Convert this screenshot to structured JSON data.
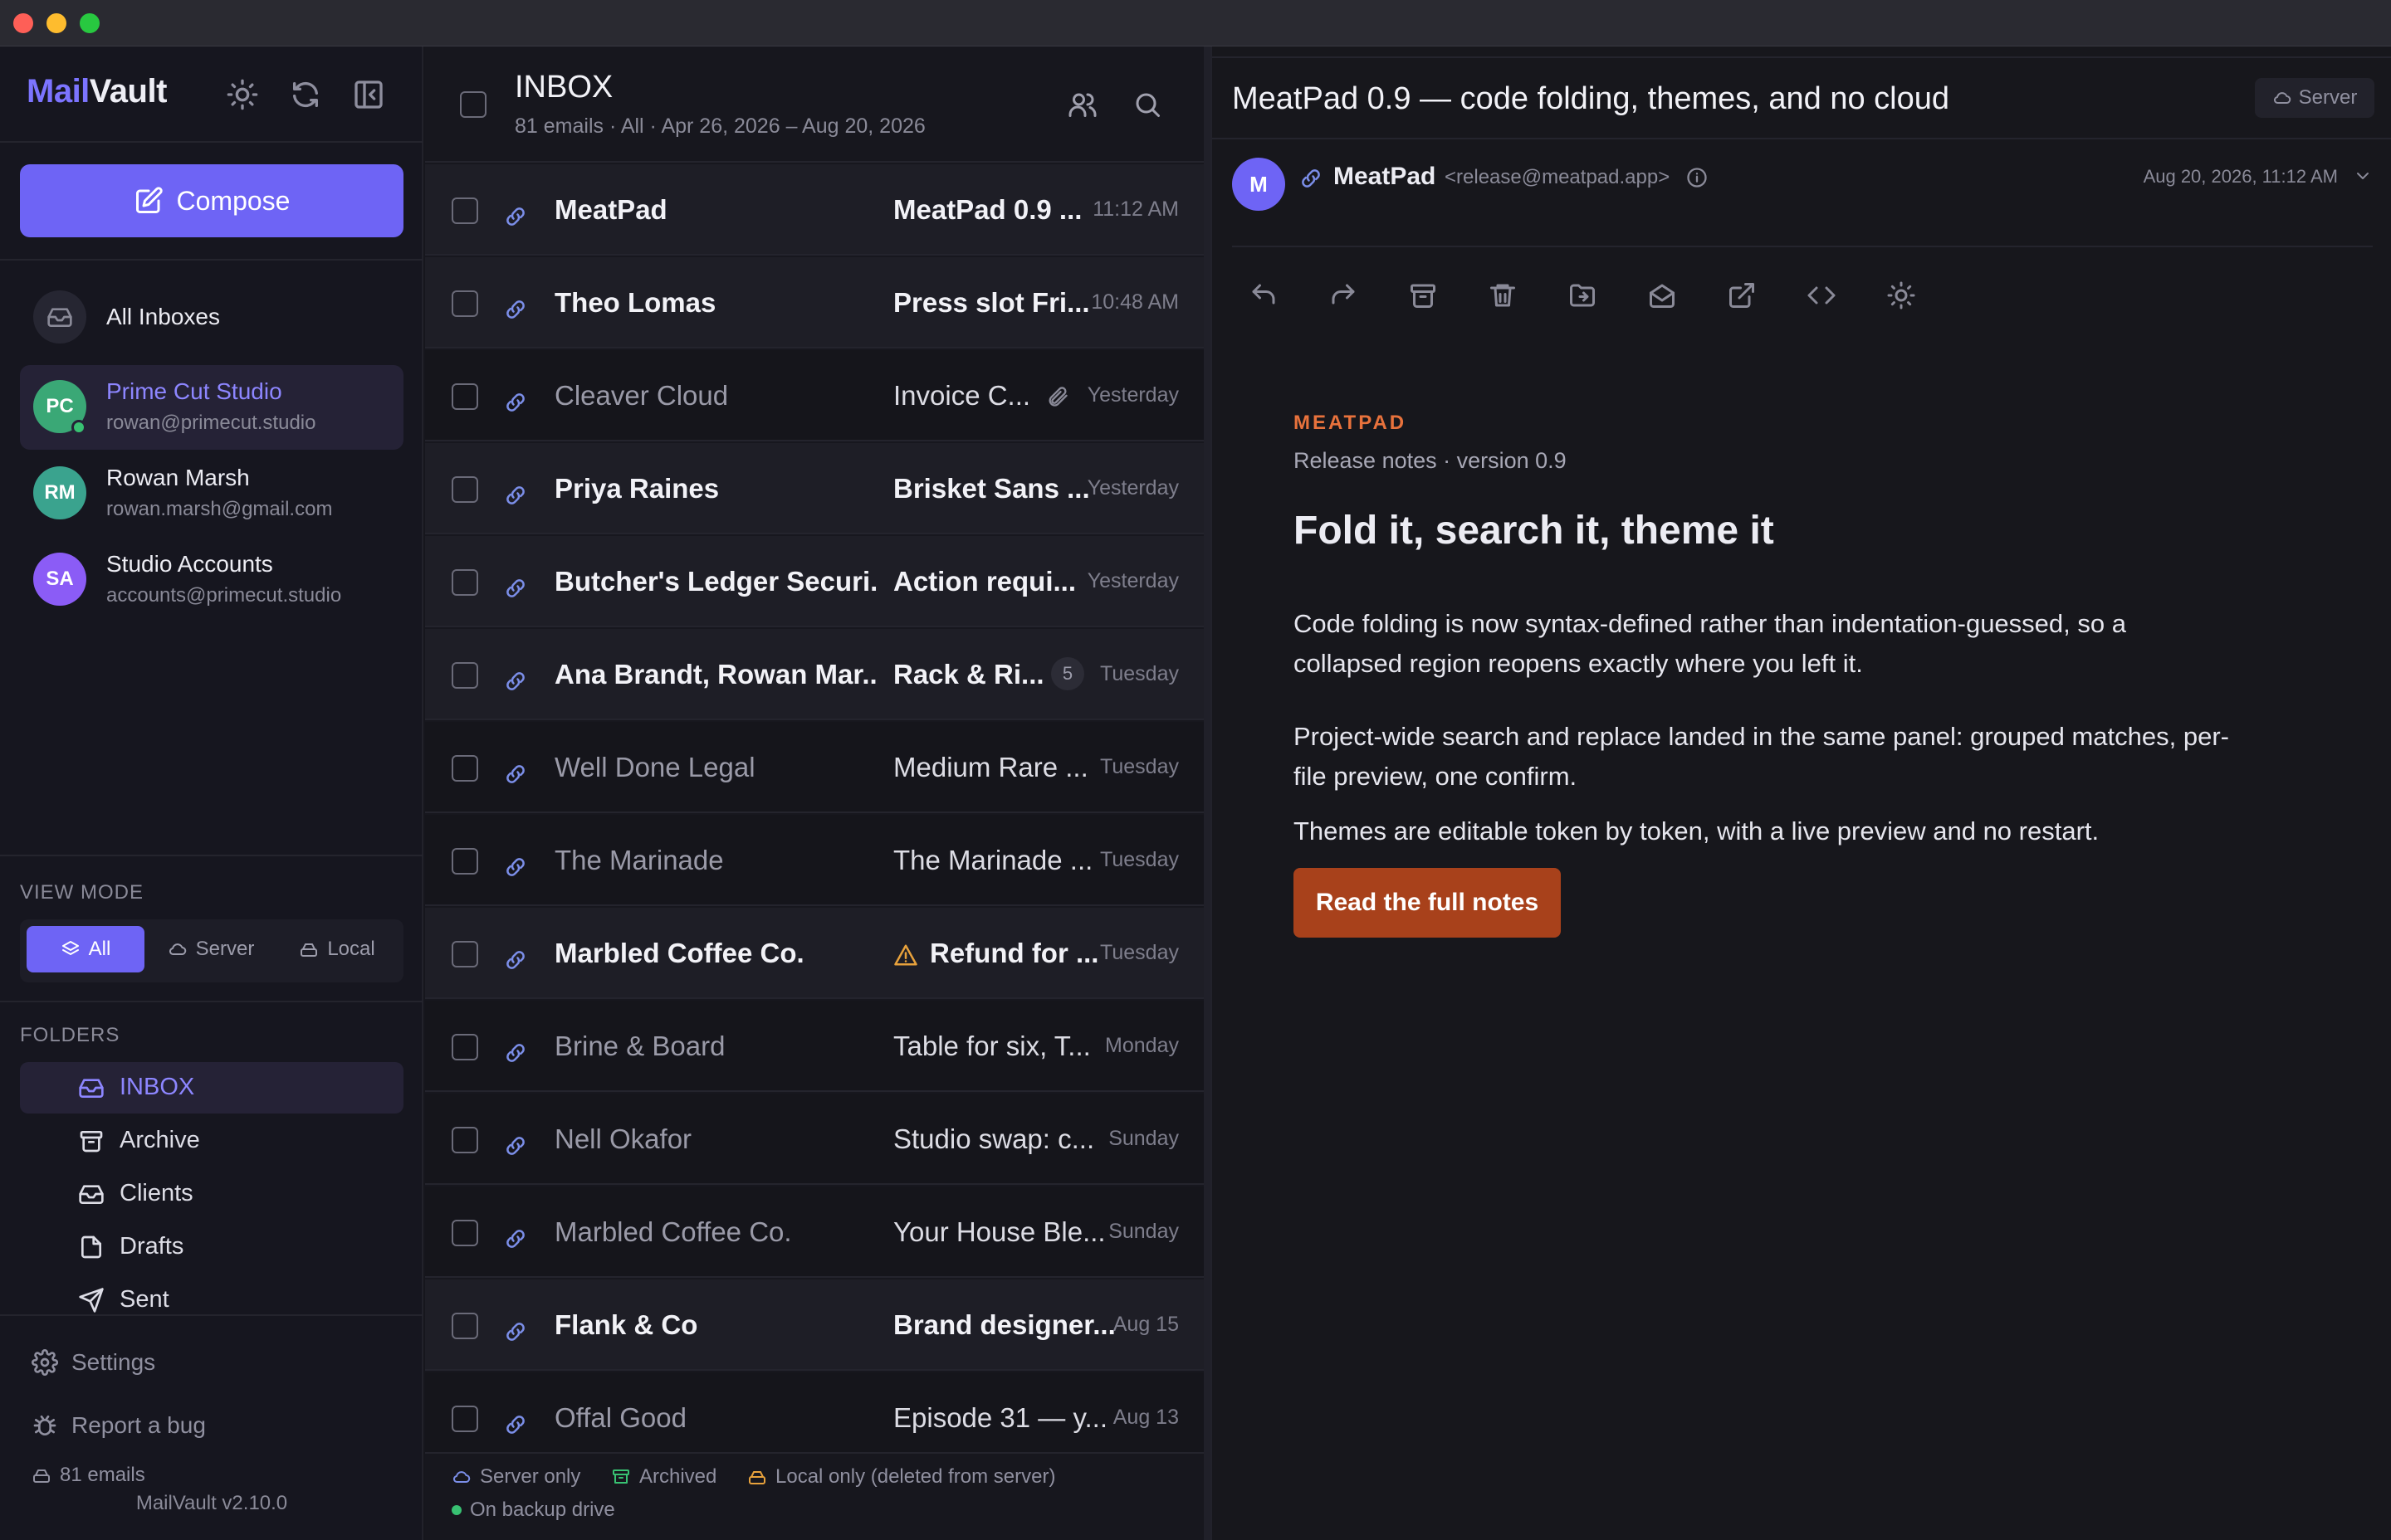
{
  "app": {
    "name_a": "Mail",
    "name_b": "Vault",
    "version": "MailVault v2.10.0"
  },
  "compose_label": "Compose",
  "accounts": [
    {
      "name": "All Inboxes",
      "email": ""
    },
    {
      "name": "Prime Cut Studio",
      "email": "rowan@primecut.studio",
      "initials": "PC"
    },
    {
      "name": "Rowan Marsh",
      "email": "rowan.marsh@gmail.com",
      "initials": "RM"
    },
    {
      "name": "Studio Accounts",
      "email": "accounts@primecut.studio",
      "initials": "SA"
    }
  ],
  "view_mode": {
    "title": "VIEW MODE",
    "options": [
      "All",
      "Server",
      "Local"
    ],
    "selected": "All"
  },
  "folders": {
    "title": "FOLDERS",
    "items": [
      "INBOX",
      "Archive",
      "Clients",
      "Drafts",
      "Sent"
    ],
    "selected": "INBOX"
  },
  "sidebar_footer": {
    "settings": "Settings",
    "report": "Report a bug",
    "count": "81 emails"
  },
  "list": {
    "title": "INBOX",
    "meta": "81 emails · All · Apr 26, 2026 – Aug 20, 2026",
    "rows": [
      {
        "from": "MeatPad",
        "subject": "MeatPad 0.9 ...",
        "date": "11:12 AM",
        "unread": true
      },
      {
        "from": "Theo Lomas",
        "subject": "Press slot Fri...",
        "date": "10:48 AM",
        "unread": true
      },
      {
        "from": "Cleaver Cloud",
        "subject": "Invoice C...",
        "date": "Yesterday",
        "unread": false,
        "attachment": true
      },
      {
        "from": "Priya Raines",
        "subject": "Brisket Sans ...",
        "date": "Yesterday",
        "unread": true
      },
      {
        "from": "Butcher's Ledger Securi...",
        "subject": "Action requi...",
        "date": "Yesterday",
        "unread": true
      },
      {
        "from": "Ana Brandt, Rowan Mar...",
        "subject": "Rack & Ri...",
        "date": "Tuesday",
        "unread": true,
        "count": "5"
      },
      {
        "from": "Well Done Legal",
        "subject": "Medium Rare ...",
        "date": "Tuesday",
        "unread": false
      },
      {
        "from": "The Marinade",
        "subject": "The Marinade ...",
        "date": "Tuesday",
        "unread": false
      },
      {
        "from": "Marbled Coffee Co.",
        "subject": "Refund for ...",
        "date": "Tuesday",
        "unread": true,
        "warning": true
      },
      {
        "from": "Brine & Board",
        "subject": "Table for six, T...",
        "date": "Monday",
        "unread": false
      },
      {
        "from": "Nell Okafor",
        "subject": "Studio swap: c...",
        "date": "Sunday",
        "unread": false
      },
      {
        "from": "Marbled Coffee Co.",
        "subject": "Your House Ble...",
        "date": "Sunday",
        "unread": false
      },
      {
        "from": "Flank & Co",
        "subject": "Brand designer...",
        "date": "Aug 15",
        "unread": true
      },
      {
        "from": "Offal Good",
        "subject": "Episode 31 — y...",
        "date": "Aug 13",
        "unread": false
      }
    ],
    "legend": [
      "Server only",
      "Archived",
      "Local only (deleted from server)",
      "On backup drive"
    ]
  },
  "reader": {
    "subject": "MeatPad 0.9 — code folding, themes, and no cloud",
    "server_badge": "Server",
    "sender_initial": "M",
    "sender_name": "MeatPad",
    "sender_email": "<release@meatpad.app>",
    "date": "Aug 20, 2026, 11:12 AM",
    "eyebrow": "MEATPAD",
    "byline": "Release notes · version 0.9",
    "headline": "Fold it, search it, theme it",
    "paragraphs": [
      "Code folding is now syntax-defined rather than indentation-guessed, so a collapsed region reopens exactly where you left it.",
      "Project-wide search and replace landed in the same panel: grouped matches, per-file preview, one confirm.",
      "Themes are editable token by token, with a live preview and no restart."
    ],
    "cta": "Read the full notes"
  },
  "colors": {
    "accent": "#6e64f5",
    "cta": "#a8411b",
    "eyebrow": "#e8723c",
    "link_icon": "#7b8ee8",
    "online": "#38c172"
  }
}
